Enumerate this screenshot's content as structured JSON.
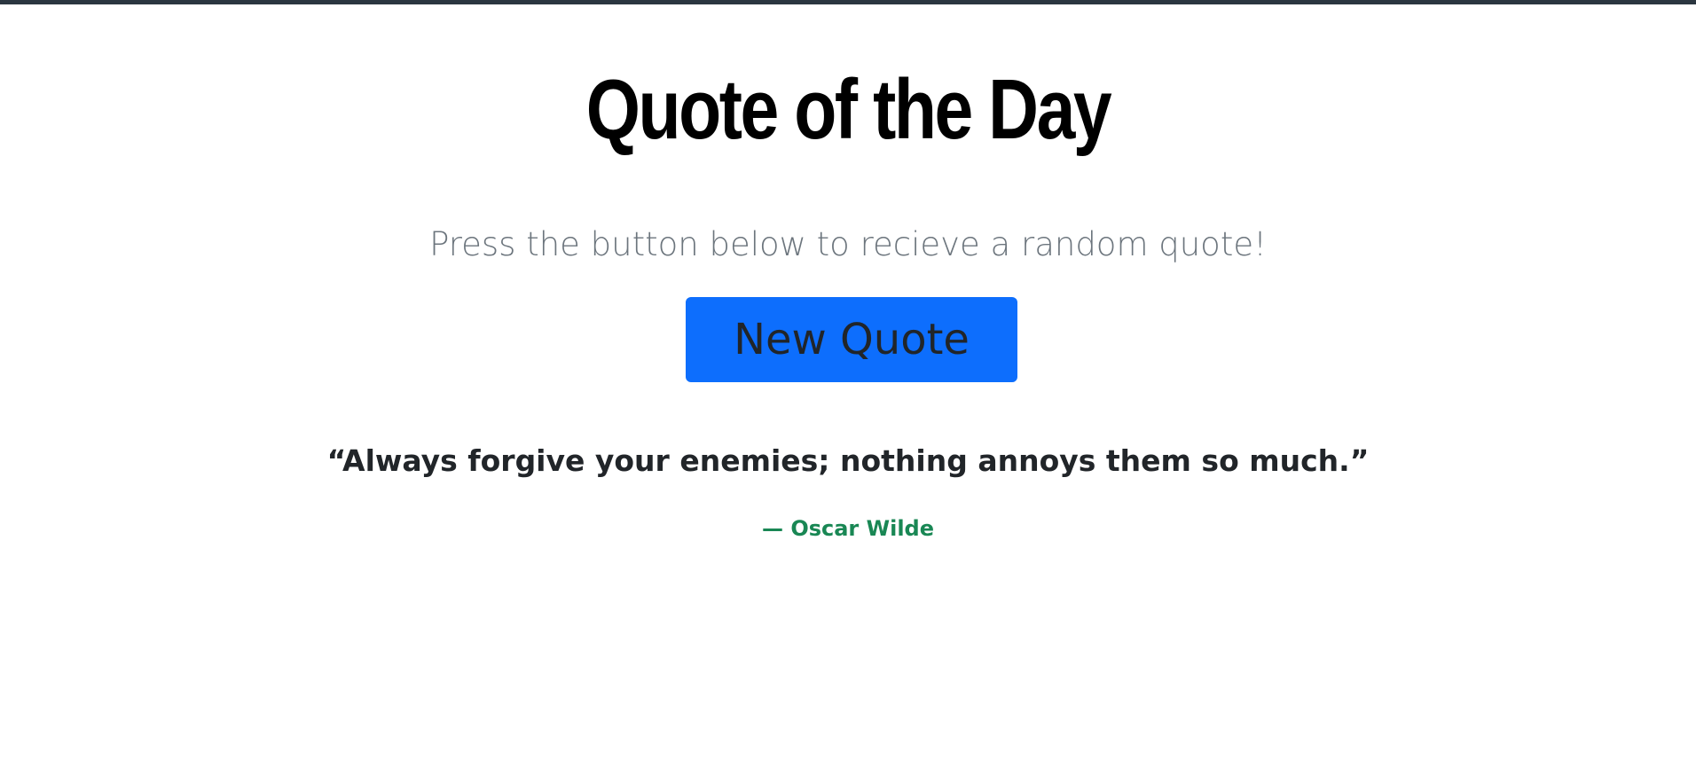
{
  "page": {
    "title": "Quote of the Day",
    "subtitle": "Press the button below to recieve a random quote!",
    "button_label": "New Quote"
  },
  "quote": {
    "text": "“Always forgive your enemies; nothing annoys them so much.”",
    "author": "— Oscar Wilde"
  },
  "colors": {
    "top_border": "#2b3640",
    "button_bg": "#0d6efd",
    "author_text": "#198754",
    "subtitle_text": "#6c757d"
  }
}
